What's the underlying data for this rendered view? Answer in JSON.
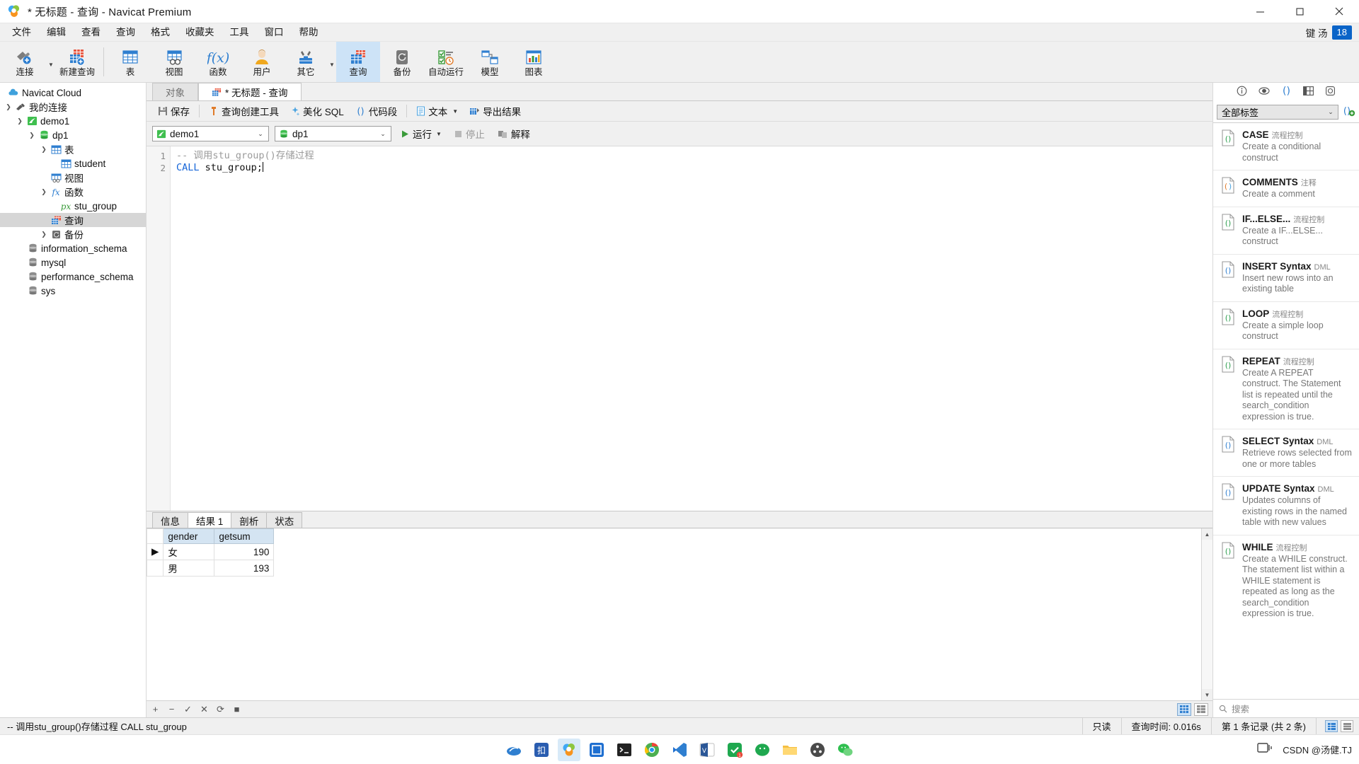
{
  "window": {
    "title": "* 无标题 - 查询 - Navicat Premium",
    "minimize": "—",
    "maximize": "□",
    "close": "✕"
  },
  "menubar": {
    "items": [
      "文件",
      "编辑",
      "查看",
      "查询",
      "格式",
      "收藏夹",
      "工具",
      "窗口",
      "帮助"
    ],
    "ime_label": "键 汤",
    "ime_badge": "18"
  },
  "toolbar": {
    "items": [
      {
        "label": "连接",
        "icon": "connection-icon",
        "caret": true
      },
      {
        "label": "新建查询",
        "icon": "new-query-icon",
        "caret": false
      },
      {
        "label": "表",
        "icon": "table-icon",
        "caret": false
      },
      {
        "label": "视图",
        "icon": "view-icon",
        "caret": false
      },
      {
        "label": "函数",
        "icon": "function-icon",
        "caret": false
      },
      {
        "label": "用户",
        "icon": "user-icon",
        "caret": false
      },
      {
        "label": "其它",
        "icon": "others-icon",
        "caret": true
      },
      {
        "label": "查询",
        "icon": "query-icon",
        "caret": false,
        "selected": true
      },
      {
        "label": "备份",
        "icon": "backup-icon",
        "caret": false
      },
      {
        "label": "自动运行",
        "icon": "automation-icon",
        "caret": false
      },
      {
        "label": "模型",
        "icon": "model-icon",
        "caret": false
      },
      {
        "label": "图表",
        "icon": "chart-icon",
        "caret": false
      }
    ]
  },
  "sidebar": {
    "items": [
      {
        "label": "Navicat Cloud",
        "icon": "cloud-icon",
        "indent": 0,
        "twisty": "",
        "name": "navicat-cloud"
      },
      {
        "label": "我的连接",
        "icon": "connections-icon",
        "indent": 0,
        "twisty": "v",
        "name": "my-connections"
      },
      {
        "label": "demo1",
        "icon": "mysql-connection-icon",
        "indent": 1,
        "twisty": "v",
        "name": "connection-demo1"
      },
      {
        "label": "dp1",
        "icon": "database-icon",
        "indent": 2,
        "twisty": "v",
        "name": "database-dp1"
      },
      {
        "label": "表",
        "icon": "tables-folder-icon",
        "indent": 3,
        "twisty": "v",
        "name": "folder-tables"
      },
      {
        "label": "student",
        "icon": "table-icon",
        "indent": 4,
        "twisty": "",
        "name": "table-student"
      },
      {
        "label": "视图",
        "icon": "views-folder-icon",
        "indent": 3,
        "twisty": "",
        "name": "folder-views"
      },
      {
        "label": "函数",
        "icon": "functions-folder-icon",
        "indent": 3,
        "twisty": "v",
        "name": "folder-functions"
      },
      {
        "label": "stu_group",
        "icon": "procedure-icon",
        "indent": 4,
        "twisty": "",
        "name": "procedure-stu-group"
      },
      {
        "label": "查询",
        "icon": "queries-folder-icon",
        "indent": 3,
        "twisty": "",
        "name": "folder-queries",
        "selected": true
      },
      {
        "label": "备份",
        "icon": "backup-folder-icon",
        "indent": 3,
        "twisty": ">",
        "name": "folder-backups"
      },
      {
        "label": "information_schema",
        "icon": "database-gray-icon",
        "indent": 2,
        "twisty": "",
        "name": "database-information-schema"
      },
      {
        "label": "mysql",
        "icon": "database-gray-icon",
        "indent": 2,
        "twisty": "",
        "name": "database-mysql"
      },
      {
        "label": "performance_schema",
        "icon": "database-gray-icon",
        "indent": 2,
        "twisty": "",
        "name": "database-performance-schema"
      },
      {
        "label": "sys",
        "icon": "database-gray-icon",
        "indent": 2,
        "twisty": "",
        "name": "database-sys"
      }
    ]
  },
  "object_tabs": {
    "objects_tab": "对象",
    "query_tab": "* 无标题 - 查询"
  },
  "query_toolbar": {
    "save": "保存",
    "query_builder": "查询创建工具",
    "beautify_sql": "美化 SQL",
    "code_snippet": "代码段",
    "text": "文本",
    "export_result": "导出结果"
  },
  "connection_bar": {
    "connection": "demo1",
    "database": "dp1",
    "run": "运行",
    "stop": "停止",
    "explain": "解释"
  },
  "editor": {
    "line_numbers": [
      "1",
      "2"
    ],
    "line1_comment": "-- 调用stu_group()存储过程",
    "line2_keyword": "CALL",
    "line2_rest": " stu_group;"
  },
  "result_tabs": {
    "items": [
      "信息",
      "结果 1",
      "剖析",
      "状态"
    ],
    "active_index": 1
  },
  "result_grid": {
    "columns": [
      "gender",
      "getsum"
    ],
    "rows": [
      {
        "marker": "▶",
        "gender": "女",
        "getsum": "190"
      },
      {
        "marker": "",
        "gender": "男",
        "getsum": "193"
      }
    ]
  },
  "result_footer": {
    "add": "+",
    "remove": "−",
    "confirm": "✓",
    "cancel": "✕",
    "refresh": "⟳",
    "stop": "■"
  },
  "right_panel": {
    "tab_icons": [
      "info-icon",
      "preview-icon",
      "snippets-icon",
      "structure-icon",
      "settings-icon"
    ],
    "filter_value": "全部标签",
    "add_snippet_icon": "add-snippet-icon",
    "search_placeholder": "搜索",
    "snippets": [
      {
        "title": "CASE",
        "tag": "流程控制",
        "desc": "Create a conditional construct",
        "icon_color": "#2e9e4f"
      },
      {
        "title": "COMMENTS",
        "tag": "注释",
        "desc": "Create a comment",
        "icon_color": "#e07b2a"
      },
      {
        "title": "IF...ELSE...",
        "tag": "流程控制",
        "desc": "Create a IF...ELSE... construct",
        "icon_color": "#2e9e4f"
      },
      {
        "title": "INSERT Syntax",
        "tag": "DML",
        "desc": "Insert new rows into an existing table",
        "icon_color": "#2f7fd0"
      },
      {
        "title": "LOOP",
        "tag": "流程控制",
        "desc": "Create a simple loop construct",
        "icon_color": "#2e9e4f"
      },
      {
        "title": "REPEAT",
        "tag": "流程控制",
        "desc": "Create A REPEAT construct. The Statement list is repeated until the search_condition expression is true.",
        "icon_color": "#2e9e4f"
      },
      {
        "title": "SELECT Syntax",
        "tag": "DML",
        "desc": "Retrieve rows selected from one or more tables",
        "icon_color": "#2f7fd0"
      },
      {
        "title": "UPDATE Syntax",
        "tag": "DML",
        "desc": "Updates columns of existing rows in the named table with new values",
        "icon_color": "#2f7fd0"
      },
      {
        "title": "WHILE",
        "tag": "流程控制",
        "desc": "Create a WHILE construct. The statement list within a WHILE statement is repeated as long as the search_condition expression is true.",
        "icon_color": "#2e9e4f"
      }
    ]
  },
  "statusbar": {
    "sql": "-- 调用stu_group()存储过程 CALL stu_group",
    "readonly": "只读",
    "query_time": "查询时间: 0.016s",
    "record_info": "第 1 条记录 (共 2 条)"
  },
  "taskbar": {
    "watermark": "CSDN @汤健.TJ",
    "apps": [
      "ime-icon",
      "app-blue-icon",
      "navicat-icon",
      "code-blue-icon",
      "terminal-icon",
      "chrome-icon",
      "vscode-icon",
      "office-icon",
      "todo-icon",
      "wechat-dev-icon",
      "explorer-icon",
      "apps-icon",
      "wechat-icon"
    ]
  },
  "colors": {
    "accent": "#2f7fd0",
    "selection": "#cde3f7",
    "header": "#d4e4f2"
  }
}
